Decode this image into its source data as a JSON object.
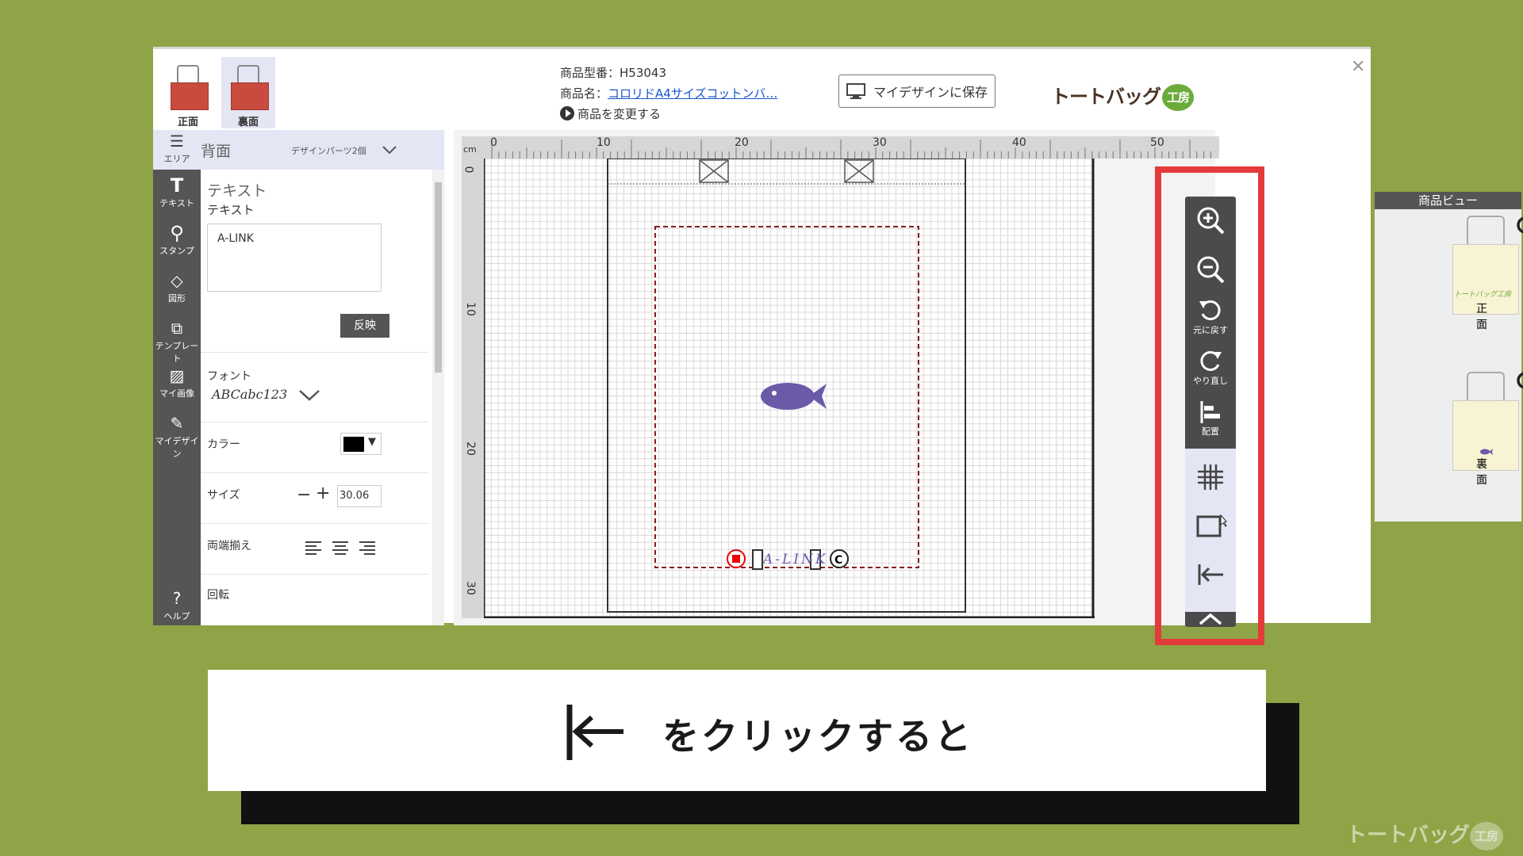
{
  "header": {
    "thumbs": [
      {
        "label": "正面"
      },
      {
        "label": "裏面"
      }
    ],
    "product_code": "商品型番：H53043",
    "product_name_prefix": "商品名：",
    "product_name_link": "コロリドA4サイズコットンバ…",
    "change_product": "商品を変更する",
    "save_button": "マイデザインに保存",
    "logo_text": "トートバッグ",
    "logo_badge": "工房"
  },
  "rail": {
    "area": "エリア",
    "text": "テキスト",
    "stamp": "スタンプ",
    "shape": "図形",
    "template": "テンプレート",
    "my_image": "マイ画像",
    "my_design": "マイデザイン",
    "help": "ヘルプ"
  },
  "area_header": {
    "title": "背面",
    "parts": "デザインパーツ2個"
  },
  "panel": {
    "section_title": "テキスト",
    "text_label": "テキスト",
    "text_value": "A-LINK",
    "apply": "反映",
    "font_label": "フォント",
    "font_sample": "ABCabc123",
    "color_label": "カラー",
    "size_label": "サイズ",
    "size_value": "30.06",
    "align_label": "両端揃え",
    "rotate_label": "回転"
  },
  "canvas": {
    "unit": "cm",
    "h_ticks": [
      "0",
      "10",
      "20",
      "30",
      "40",
      "50"
    ],
    "v_ticks": [
      "0",
      "10",
      "20",
      "30"
    ],
    "text_object": "A-LINK",
    "accent_color": "#6b5aa8"
  },
  "toolbar": {
    "undo": "元に戻す",
    "redo": "やり直し",
    "arrange": "配置",
    "highlight_color": "#e33b3c"
  },
  "product_view": {
    "title": "商品ビュー",
    "front": "正面",
    "back": "裏面",
    "front_logo": "トートバッグ工房"
  },
  "caption": {
    "text": "をクリックすると"
  },
  "watermark": {
    "text": "トートバッグ",
    "badge": "工房"
  }
}
